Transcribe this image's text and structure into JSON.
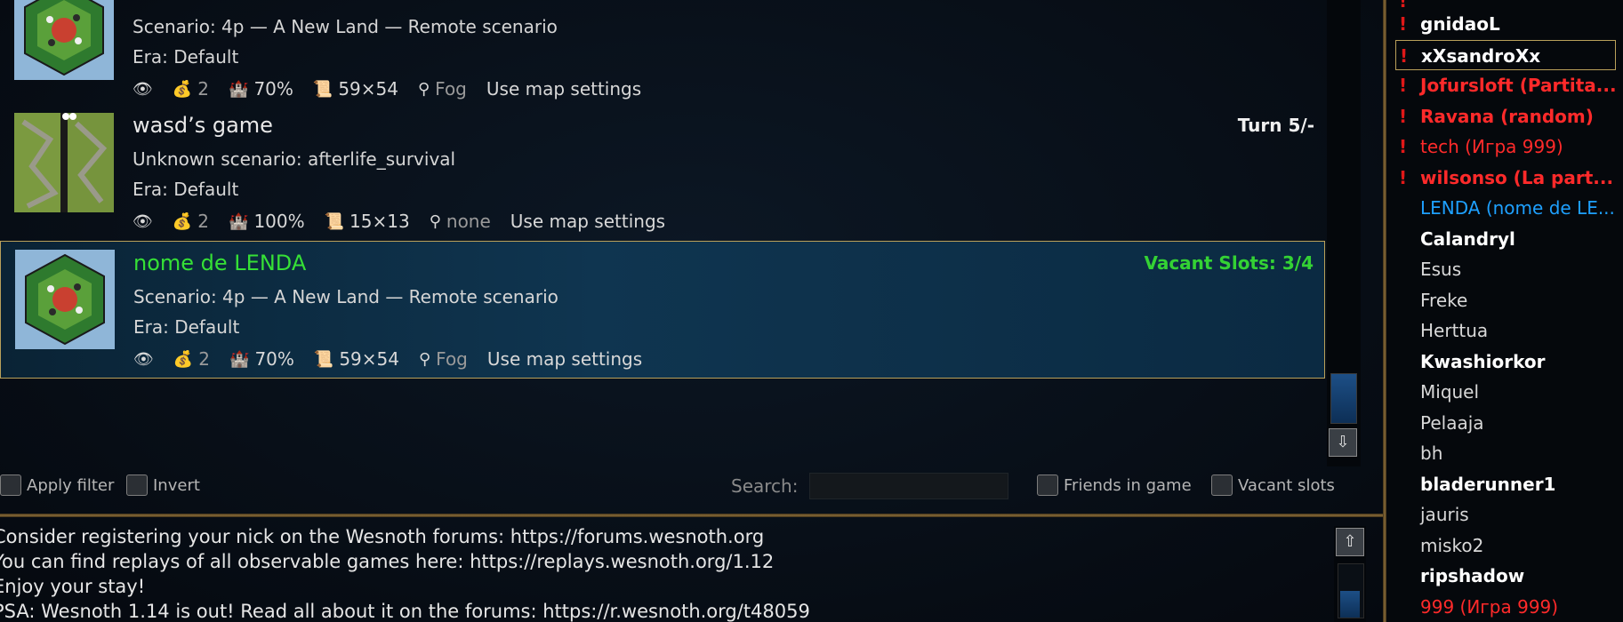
{
  "games": [
    {
      "title": "",
      "status": "",
      "scenario": "Scenario: 4p — A New Land — Remote scenario",
      "era": "Era: Default",
      "players": "2",
      "village_gold": "70%",
      "map_size": "59×54",
      "time": "Fog",
      "map_settings": "Use map settings",
      "map_type": "hex-island"
    },
    {
      "title": "wasd’s game",
      "status": "Turn 5/-",
      "scenario": "Unknown scenario: afterlife_survival",
      "era": "Era: Default",
      "players": "2",
      "village_gold": "100%",
      "map_size": "15×13",
      "time": "none",
      "map_settings": "Use map settings",
      "map_type": "two-lanes"
    },
    {
      "title": "nome de LENDA",
      "status": "Vacant Slots: 3/4",
      "scenario": "Scenario: 4p — A New Land — Remote scenario",
      "era": "Era: Default",
      "players": "2",
      "village_gold": "70%",
      "map_size": "59×54",
      "time": "Fog",
      "map_settings": "Use map settings",
      "map_type": "hex-island"
    }
  ],
  "filter": {
    "apply_filter": "Apply filter",
    "invert": "Invert",
    "search_label": "Search:",
    "search_value": "",
    "friends_in_game": "Friends in game",
    "vacant_slots": "Vacant slots"
  },
  "chat": {
    "lines": [
      "Consider registering your nick on the Wesnoth forums: https://forums.wesnoth.org",
      "You can find replays of all observable games here: https://replays.wesnoth.org/1.12",
      "Enjoy your stay!",
      "PSA: Wesnoth 1.14 is out! Read all about it on the forums: https://r.wesnoth.org/t48059"
    ]
  },
  "users": [
    {
      "name": "gnidaoL",
      "alert": true,
      "color": "#ffffff",
      "bold": true
    },
    {
      "name": "xXsandroXx",
      "alert": true,
      "color": "#ffffff",
      "bold": true,
      "selected": true
    },
    {
      "name": "Jofursloft (Partita...",
      "alert": true,
      "color": "#ff2a2a",
      "bold": true
    },
    {
      "name": "Ravana (random)",
      "alert": true,
      "color": "#ff2a2a",
      "bold": true
    },
    {
      "name": "tech (Игра 999)",
      "alert": true,
      "color": "#ff2a2a",
      "bold": false
    },
    {
      "name": "wilsonso (La part...",
      "alert": true,
      "color": "#ff2a2a",
      "bold": true
    },
    {
      "name": "LENDA (nome de LE...",
      "alert": false,
      "color": "#1ea0ff",
      "bold": false
    },
    {
      "name": "Calandryl",
      "alert": false,
      "color": "#ffffff",
      "bold": true
    },
    {
      "name": "Esus",
      "alert": false,
      "color": "#d8d8d8",
      "bold": false
    },
    {
      "name": "Freke",
      "alert": false,
      "color": "#d8d8d8",
      "bold": false
    },
    {
      "name": "Herttua",
      "alert": false,
      "color": "#d8d8d8",
      "bold": false
    },
    {
      "name": "Kwashiorkor",
      "alert": false,
      "color": "#ffffff",
      "bold": true
    },
    {
      "name": "Miquel",
      "alert": false,
      "color": "#d8d8d8",
      "bold": false
    },
    {
      "name": "Pelaaja",
      "alert": false,
      "color": "#d8d8d8",
      "bold": false
    },
    {
      "name": "bh",
      "alert": false,
      "color": "#d8d8d8",
      "bold": false
    },
    {
      "name": "bladerunner1",
      "alert": false,
      "color": "#ffffff",
      "bold": true
    },
    {
      "name": "jauris",
      "alert": false,
      "color": "#d8d8d8",
      "bold": false
    },
    {
      "name": "misko2",
      "alert": false,
      "color": "#d8d8d8",
      "bold": false
    },
    {
      "name": "ripshadow",
      "alert": false,
      "color": "#ffffff",
      "bold": true
    },
    {
      "name": "999 (Игра 999)",
      "alert": false,
      "color": "#ff2a2a",
      "bold": false
    }
  ],
  "icons": {
    "observer": "eye-icon",
    "players": "gold-coins-icon",
    "villages": "castle-icon",
    "map_size": "scroll-map-icon",
    "time": "torch-icon",
    "scroll_down": "down-arrow-icon",
    "scroll_up": "up-arrow-icon"
  },
  "colors": {
    "selected_border": "#b9a05a",
    "vacant_green": "#34d234",
    "alert_red": "#e01818",
    "friend_blue": "#1ea0ff"
  }
}
